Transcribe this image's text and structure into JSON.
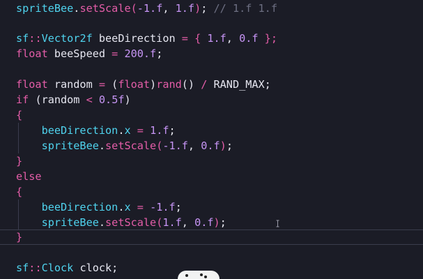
{
  "code": {
    "l1": {
      "a": "spriteBee",
      "b": ".",
      "c": "setScale",
      "d": "(",
      "e": "-1.f",
      "f": ", ",
      "g": "1.f",
      "h": ")",
      "i": "; ",
      "j": "// 1.f 1.f"
    },
    "l3": {
      "a": "sf",
      "b": "::",
      "c": "Vector2f",
      "d": " beeDirection ",
      "e": "=",
      "f": " { ",
      "g": "1.f",
      "h": ", ",
      "i": "0.f",
      "j": " };"
    },
    "l4": {
      "a": "float",
      "b": " beeSpeed ",
      "c": "=",
      "d": " ",
      "e": "200.f",
      "f": ";"
    },
    "l6": {
      "a": "float",
      "b": " random ",
      "c": "=",
      "d": " (",
      "e": "float",
      "f": ")",
      "g": "rand",
      "h": "() ",
      "i": "/",
      "j": " RAND_MAX;"
    },
    "l7": {
      "a": "if",
      "b": " (random ",
      "c": "<",
      "d": " ",
      "e": "0.5f",
      "f": ")"
    },
    "l8": {
      "a": "{"
    },
    "l9": {
      "a": "    beeDirection",
      "b": ".",
      "c": "x",
      "d": " ",
      "e": "=",
      "f": " ",
      "g": "1.f",
      "h": ";"
    },
    "l10": {
      "a": "    spriteBee",
      "b": ".",
      "c": "setScale",
      "d": "(",
      "e": "-1.f",
      "f": ", ",
      "g": "0.f",
      "h": ")",
      "i": ";"
    },
    "l11": {
      "a": "}"
    },
    "l12": {
      "a": "else"
    },
    "l13": {
      "a": "{"
    },
    "l14": {
      "a": "    beeDirection",
      "b": ".",
      "c": "x",
      "d": " ",
      "e": "=",
      "f": " ",
      "g": "-1.f",
      "h": ";"
    },
    "l15": {
      "a": "    spriteBee",
      "b": ".",
      "c": "setScale",
      "d": "(",
      "e": "1.f",
      "f": ", ",
      "g": "0.f",
      "h": ")",
      "i": ";"
    },
    "l16": {
      "a": "}"
    },
    "l18": {
      "a": "sf",
      "b": "::",
      "c": "Clock",
      "d": " clock;"
    }
  },
  "colors": {
    "background": "#1b1c26",
    "identifier": "#4fd3ee",
    "keyword": "#e45da8",
    "number": "#c795f5",
    "comment": "#6d6f82",
    "text": "#e6e6f0"
  },
  "icons": {
    "cursor": "ibeam-cursor-icon",
    "overlay": "media-controls-icon"
  }
}
